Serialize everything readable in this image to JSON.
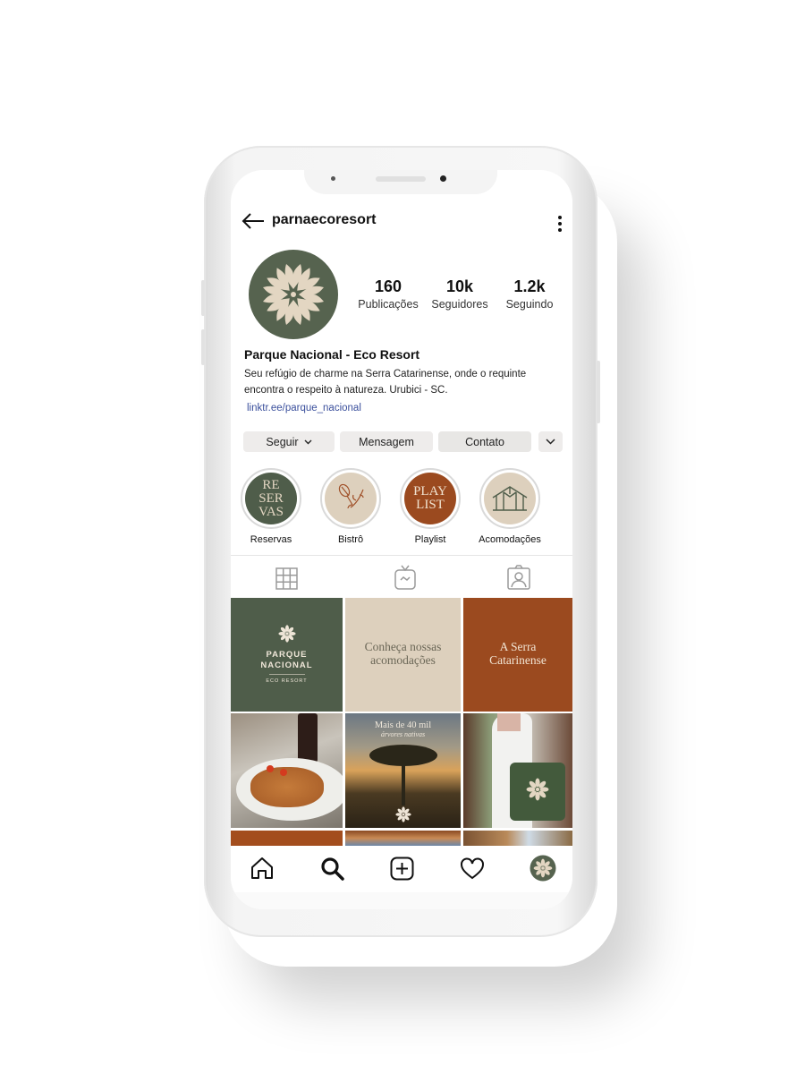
{
  "header": {
    "username": "parnaecoresort",
    "back_icon": "arrow-left-icon",
    "more_icon": "kebab-icon"
  },
  "profile": {
    "stats": [
      {
        "value": "160",
        "label": "Publicações"
      },
      {
        "value": "10k",
        "label": "Seguidores"
      },
      {
        "value": "1.2k",
        "label": "Seguindo"
      }
    ],
    "name": "Parque Nacional - Eco Resort",
    "bio_line1": "Seu refúgio de charme na Serra Catarinense, onde o requinte",
    "bio_line2": "encontra o respeito à natureza. Urubici - SC.",
    "link": "linktr.ee/parque_nacional"
  },
  "buttons": {
    "follow": "Seguir",
    "message": "Mensagem",
    "contact": "Contato"
  },
  "highlights": [
    {
      "label": "Reservas",
      "cover_text": [
        "RE",
        "SER",
        "VAS"
      ],
      "color": "#4f5d4a"
    },
    {
      "label": "Bistrô",
      "color": "#ddd0bd"
    },
    {
      "label": "Playlist",
      "cover_text": [
        "PLAY",
        "LIST"
      ],
      "color": "#9b4a1f"
    },
    {
      "label": "Acomodações",
      "color": "#ddd0bd"
    }
  ],
  "tabs": [
    "grid-icon",
    "igtv-icon",
    "tagged-icon"
  ],
  "posts": {
    "p1": {
      "line1": "PARQUE",
      "line2": "NACIONAL",
      "line3": "ECO RESORT"
    },
    "p2": {
      "line1": "Conheça nossas",
      "line2": "acomodações"
    },
    "p3": {
      "line1": "A Serra",
      "line2": "Catarinense"
    },
    "p5": {
      "line1": "Mais de 40 mil",
      "line2": "árvores nativas"
    }
  },
  "colors": {
    "green": "#4f5d4a",
    "beige": "#ddd0bd",
    "rust": "#9b4a1f",
    "link": "#3a4f9c"
  },
  "bottom_nav": [
    "home-icon",
    "search-icon",
    "add-icon",
    "heart-icon",
    "profile-avatar"
  ]
}
